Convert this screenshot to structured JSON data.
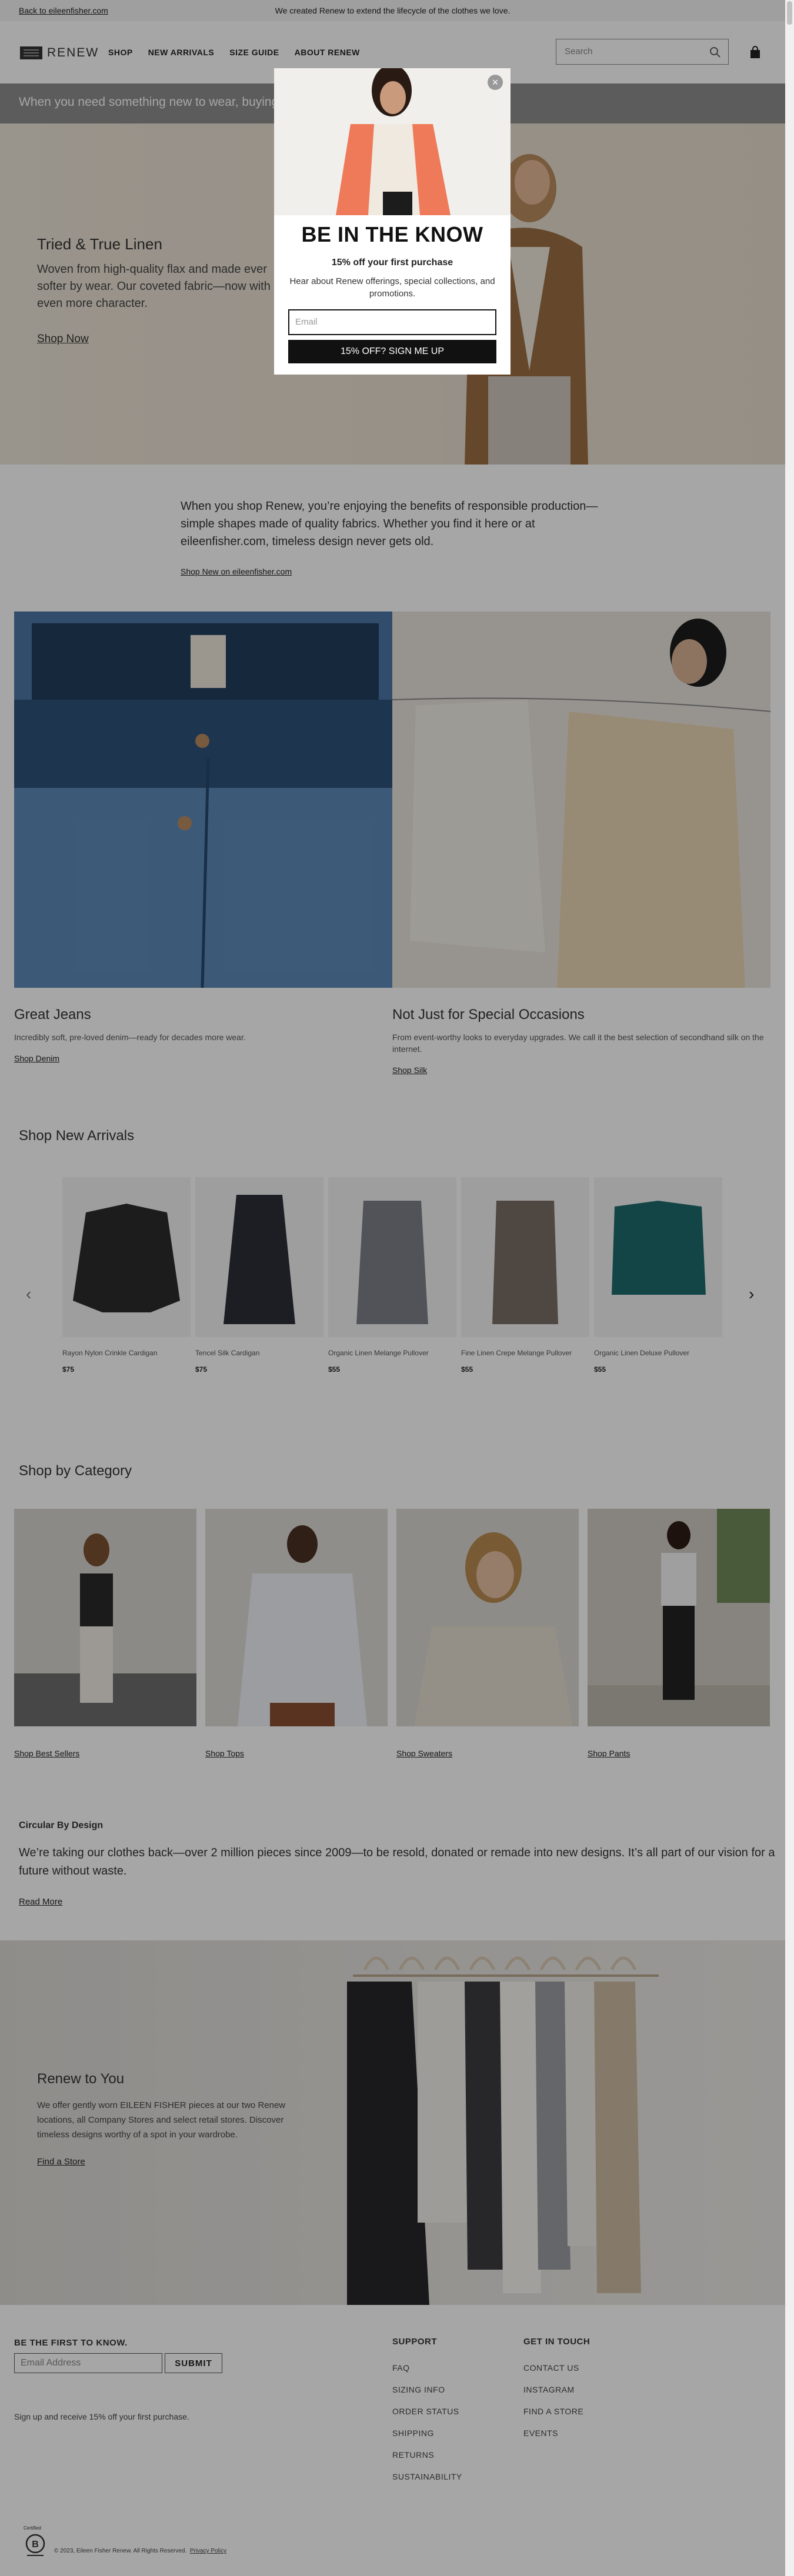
{
  "topbar": {
    "back_link": "Back to eileenfisher.com",
    "message": "We created Renew to extend the lifecycle of the clothes we love."
  },
  "header": {
    "logo_text": "RENEW",
    "nav": [
      "SHOP",
      "NEW ARRIVALS",
      "SIZE GUIDE",
      "ABOUT RENEW"
    ],
    "search_placeholder": "Search"
  },
  "promo_strip": "When you need something new to wear, buying",
  "hero": {
    "title": "Tried & True Linen",
    "body": "Woven from high-quality flax and made ever softer by wear. Our coveted fabric—now with even more character.",
    "cta": "Shop Now"
  },
  "intro": {
    "text": "When you shop Renew, you’re enjoying the benefits of responsible production—simple shapes made of quality fabrics. Whether you find it here or at eileenfisher.com, timeless design never gets old.",
    "link": "Shop New on eileenfisher.com"
  },
  "features": [
    {
      "title": "Great Jeans",
      "body": "Incredibly soft, pre-loved denim—ready for decades more wear.",
      "link": "Shop Denim"
    },
    {
      "title": "Not Just for Special Occasions",
      "body": "From event-worthy looks to everyday upgrades. We call it the best selection of secondhand silk on the internet.",
      "link": "Shop Silk"
    }
  ],
  "new_arrivals": {
    "title": "Shop New Arrivals",
    "products": [
      {
        "name": "Rayon Nylon Crinkle Cardigan",
        "price": "$75",
        "color": "#2b2b2b"
      },
      {
        "name": "Tencel Silk Cardigan",
        "price": "$75",
        "color": "#2d2f38"
      },
      {
        "name": "Organic Linen Melange Pullover",
        "price": "$55",
        "color": "#7d8088"
      },
      {
        "name": "Fine Linen Crepe Melange Pullover",
        "price": "$55",
        "color": "#7a6e64"
      },
      {
        "name": "Organic Linen Deluxe Pullover",
        "price": "$55",
        "color": "#1e6a6c"
      }
    ]
  },
  "categories": {
    "title": "Shop by Category",
    "items": [
      "Shop Best Sellers",
      "Shop Tops",
      "Shop Sweaters",
      "Shop Pants"
    ]
  },
  "circular": {
    "heading": "Circular By Design",
    "text": "We’re taking our clothes back—over 2 million pieces since 2009—to be resold, donated or remade into new designs. It’s all part of our vision for a future without waste.",
    "link": "Read More"
  },
  "renew_to_you": {
    "title": "Renew to You",
    "body": "We offer gently worn EILEEN FISHER pieces at our two Renew locations, all Company Stores and select retail stores. Discover timeless designs worthy of a spot in your wardrobe.",
    "link": "Find a Store"
  },
  "footer": {
    "newsletter_title": "BE THE FIRST TO KNOW.",
    "email_placeholder": "Email Address",
    "submit": "SUBMIT",
    "signup_note": "Sign up and receive 15% off your first purchase.",
    "support_title": "SUPPORT",
    "support_links": [
      "FAQ",
      "SIZING INFO",
      "ORDER STATUS",
      "SHIPPING",
      "RETURNS",
      "SUSTAINABILITY"
    ],
    "contact_title": "GET IN TOUCH",
    "contact_links": [
      "CONTACT US",
      "INSTAGRAM",
      "FIND A STORE",
      "EVENTS"
    ],
    "bcorp_label": "Certified",
    "copyright": "© 2023, Eileen Fisher Renew.  All Rights Reserved.",
    "privacy": "Privacy Policy"
  },
  "modal": {
    "title": "BE IN THE KNOW",
    "subtitle": "15% off your first purchase",
    "description": "Hear about Renew offerings, special collections, and promotions.",
    "email_placeholder": "Email",
    "button": "15% OFF? SIGN ME UP",
    "close": "×"
  }
}
